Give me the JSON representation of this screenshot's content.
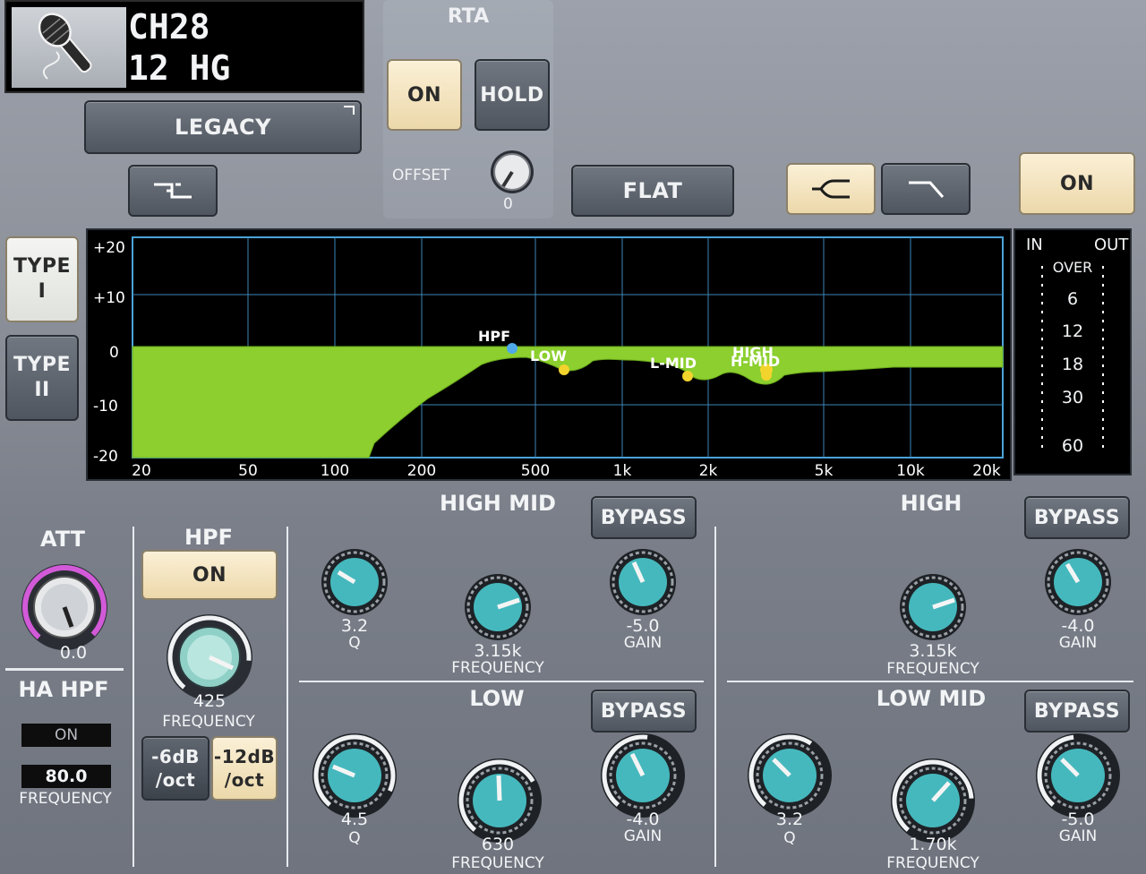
{
  "channel": {
    "id": "CH28",
    "name": "12 HG",
    "icon": "microphone-icon"
  },
  "legacy_button": "LEGACY",
  "rta": {
    "title": "RTA",
    "on_label": "ON",
    "hold_label": "HOLD",
    "offset_label": "OFFSET",
    "offset_value": "0"
  },
  "flat_button": "FLAT",
  "eq_on_button": "ON",
  "type_buttons": {
    "type1": [
      "TYPE",
      "I"
    ],
    "type2": [
      "TYPE",
      "II"
    ]
  },
  "graph": {
    "y_ticks": [
      "+20",
      "+10",
      "0",
      "-10",
      "-20"
    ],
    "x_ticks": [
      "20",
      "50",
      "100",
      "200",
      "500",
      "1k",
      "2k",
      "5k",
      "10k",
      "20k"
    ],
    "markers": [
      "HPF",
      "LOW",
      "L-MID",
      "H-MID",
      "HIGH"
    ]
  },
  "meter": {
    "in_label": "IN",
    "out_label": "OUT",
    "scale": [
      "OVER",
      "6",
      "12",
      "18",
      "30",
      "60"
    ]
  },
  "att": {
    "title": "ATT",
    "value": "0.0"
  },
  "ha_hpf": {
    "title": "HA HPF",
    "on_label": "ON",
    "frequency_value": "80.0",
    "frequency_label": "FREQUENCY"
  },
  "hpf": {
    "title": "HPF",
    "on_label": "ON",
    "frequency_value": "425",
    "frequency_label": "FREQUENCY",
    "slope_6": [
      "-6dB",
      "/oct"
    ],
    "slope_12": [
      "-12dB",
      "/oct"
    ]
  },
  "high_mid": {
    "title": "HIGH MID",
    "bypass": "BYPASS",
    "q_value": "3.2",
    "q_label": "Q",
    "freq_value": "3.15k",
    "freq_label": "FREQUENCY",
    "gain_value": "-5.0",
    "gain_label": "GAIN"
  },
  "high": {
    "title": "HIGH",
    "bypass": "BYPASS",
    "freq_value": "3.15k",
    "freq_label": "FREQUENCY",
    "gain_value": "-4.0",
    "gain_label": "GAIN"
  },
  "low": {
    "title": "LOW",
    "bypass": "BYPASS",
    "q_value": "4.5",
    "q_label": "Q",
    "freq_value": "630",
    "freq_label": "FREQUENCY",
    "gain_value": "-4.0",
    "gain_label": "GAIN"
  },
  "low_mid": {
    "title": "LOW MID",
    "bypass": "BYPASS",
    "q_value": "3.2",
    "q_label": "Q",
    "freq_value": "1.70k",
    "freq_label": "FREQUENCY",
    "gain_value": "-5.0",
    "gain_label": "GAIN"
  },
  "colors": {
    "eq_fill": "#8ccf2e",
    "knob_teal": "#45b8bd",
    "on_cream": "#f5e6c0",
    "graph_line": "#5fb0e0",
    "att_ring": "#d25ad8"
  }
}
